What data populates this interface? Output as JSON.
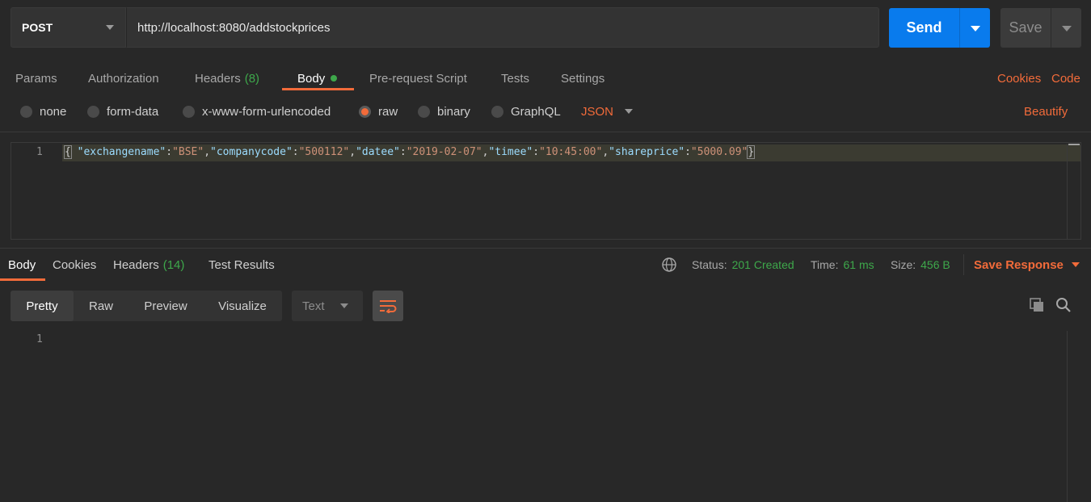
{
  "request": {
    "method": "POST",
    "url": "http://localhost:8080/addstockprices",
    "send_label": "Send",
    "save_label": "Save"
  },
  "request_tabs": [
    {
      "label": "Params"
    },
    {
      "label": "Authorization"
    },
    {
      "label": "Headers",
      "count": "(8)"
    },
    {
      "label": "Body",
      "active": true
    },
    {
      "label": "Pre-request Script"
    },
    {
      "label": "Tests"
    },
    {
      "label": "Settings"
    }
  ],
  "right_links": {
    "cookies": "Cookies",
    "code": "Code"
  },
  "body_types": [
    {
      "label": "none",
      "selected": false
    },
    {
      "label": "form-data",
      "selected": false
    },
    {
      "label": "x-www-form-urlencoded",
      "selected": false
    },
    {
      "label": "raw",
      "selected": true
    },
    {
      "label": "binary",
      "selected": false
    },
    {
      "label": "GraphQL",
      "selected": false
    }
  ],
  "raw_format": "JSON",
  "beautify_label": "Beautify",
  "editor": {
    "line_number": "1",
    "tokens": {
      "open": "{",
      "k1": "\"exchangename\"",
      "v1": "\"BSE\"",
      "k2": "\"companycode\"",
      "v2": "\"500112\"",
      "k3": "\"datee\"",
      "v3": "\"2019-02-07\"",
      "k4": "\"timee\"",
      "v4": "\"10:45:00\"",
      "k5": "\"shareprice\"",
      "v5": "\"5000.09\"",
      "close": "}"
    }
  },
  "response_tabs": [
    {
      "label": "Body",
      "active": true
    },
    {
      "label": "Cookies"
    },
    {
      "label": "Headers",
      "count": "(14)"
    },
    {
      "label": "Test Results"
    }
  ],
  "response_meta": {
    "status_label": "Status:",
    "status_value": "201 Created",
    "time_label": "Time:",
    "time_value": "61 ms",
    "size_label": "Size:",
    "size_value": "456 B",
    "save_response": "Save Response"
  },
  "view_modes": [
    {
      "label": "Pretty",
      "active": true
    },
    {
      "label": "Raw"
    },
    {
      "label": "Preview"
    },
    {
      "label": "Visualize"
    }
  ],
  "response_format": "Text",
  "response_line_number": "1",
  "colors": {
    "accent": "#f26b3a",
    "primary": "#097bed",
    "success": "#3ea84b",
    "background": "#282828"
  }
}
